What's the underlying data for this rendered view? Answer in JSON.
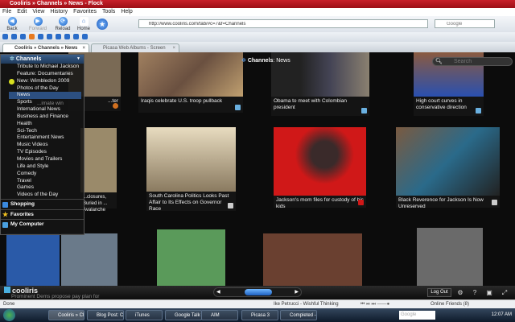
{
  "window": {
    "title": "Cooliris » Channels » News - Flock"
  },
  "menu": [
    "File",
    "Edit",
    "View",
    "History",
    "Favorites",
    "Tools",
    "Help"
  ],
  "nav": {
    "back": "Back",
    "forward": "Forward",
    "reload": "Reload",
    "home": "Home",
    "url": "http://www.cooliris.com/tab/#c=7&f=Channels",
    "search_placeholder": "Google"
  },
  "tabs": [
    {
      "label": "Cooliris » Channels » News",
      "active": true
    },
    {
      "label": "Picasa Web Albums - Screen Captur...",
      "active": false
    }
  ],
  "channels": {
    "header": "Channels",
    "breadcrumb_label": "Channels",
    "breadcrumb_current": ": News",
    "search_placeholder": "Search",
    "items": [
      "Tribute to Michael Jackson",
      "Feature: Documentaries",
      "New: Wimbledon 2009",
      "Photos of the Day",
      "News",
      "Sports",
      "International News",
      "Business and Finance",
      "Health",
      "Sci-Tech",
      "Entertainment News",
      "Music Videos",
      "TV Episodes",
      "Movies and Trailers",
      "Life and Style",
      "Comedy",
      "Travel",
      "Games",
      "Videos of the Day"
    ],
    "selected": "News",
    "sections": [
      "Shopping",
      "Favorites",
      "My Computer"
    ]
  },
  "cards": [
    {
      "caption": "...ter"
    },
    {
      "caption": "Iraqis celebrate U.S. troop pullback"
    },
    {
      "caption": "Obama to meet with Colombian president"
    },
    {
      "caption": "High court curves in conservative direction"
    },
    {
      "caption": "...closures, Buried in ... Avalanche"
    },
    {
      "caption": "South Carolina Politics Looks Past Affair to Its Effects on Governor Race"
    },
    {
      "caption": "Jackson's mom files for custody of his kids"
    },
    {
      "caption": "Black Reverence for Jackson Is Now Unreserved"
    }
  ],
  "peek_texts": [
    "...imate win",
    "Prominent Dems propose pay plan for"
  ],
  "cooliris_bar": {
    "logo": "cooliris",
    "logout": "Log Out",
    "help": "?"
  },
  "status": {
    "text": "Done",
    "music": "Ike Petrucci - Wishful Thinking",
    "friends": "Online Friends (8)"
  },
  "taskbar": {
    "items": [
      "Cooliris » Cha...",
      "Blog Post: Coo...",
      "iTunes",
      "Google Talk",
      "AIM",
      "Picasa 3",
      "Completed - U..."
    ],
    "search": "Google",
    "clock": "12:07 AM"
  }
}
